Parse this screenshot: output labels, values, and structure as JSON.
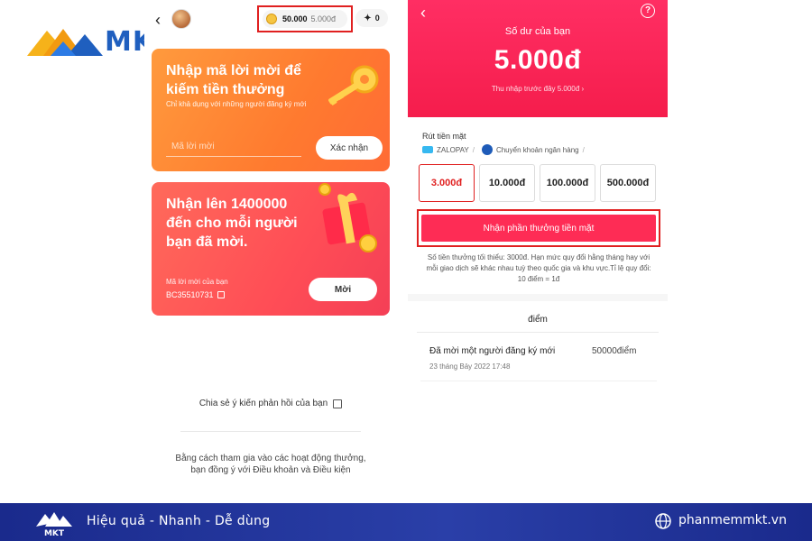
{
  "logo": {
    "text": "MKT"
  },
  "left_screen": {
    "coins": {
      "amount": "50.000",
      "cash_value": "5.000đ"
    },
    "tickets": {
      "count": "0"
    },
    "invite_card": {
      "title": "Nhập mã lời mời để kiếm tiền thưởng",
      "subtitle": "Chỉ khả dụng với những người đăng ký mới",
      "input_placeholder": "Mã lời mời",
      "confirm_label": "Xác nhận"
    },
    "reward_card": {
      "title": "Nhận lên 1400000 đến cho mỗi người bạn đã mời.",
      "code_label": "Mã lời mời của bạn",
      "code_value": "BC35510731",
      "invite_label": "Mời"
    },
    "feedback": "Chia sẻ ý kiến phản hồi của bạn",
    "terms": "Bằng cách tham gia vào các hoạt động thưởng, bạn đồng ý với Điều khoản và Điều kiện"
  },
  "right_screen": {
    "balance_label": "Số dư của bạn",
    "balance_value": "5.000đ",
    "prev_income": "Thu nhập trước đây 5.000đ",
    "withdraw_label": "Rút tiền mặt",
    "methods": [
      "ZALOPAY",
      "Chuyển khoản ngân hàng"
    ],
    "amounts": [
      {
        "label": "3.000đ",
        "selected": true
      },
      {
        "label": "10.000đ",
        "selected": false
      },
      {
        "label": "100.000đ",
        "selected": false
      },
      {
        "label": "500.000đ",
        "selected": false
      }
    ],
    "redeem_label": "Nhận phần thưởng tiền mặt",
    "min_note": "Số tiền thưởng tối thiểu: 3000đ. Hạn mức quy đổi hằng tháng hay với mỗi giao dịch sẽ khác nhau tuỳ theo quốc gia và khu vực.Tỉ lệ quy đổi: 10 điểm = 1đ",
    "points_title": "điểm",
    "history": [
      {
        "title": "Đã mời một người đăng ký mới",
        "date": "23 tháng Bảy 2022 17:48",
        "points": "50000điểm"
      }
    ]
  },
  "footer": {
    "slogan": "Hiệu quả - Nhanh - Dễ dùng",
    "website": "phanmemmkt.vn"
  },
  "colors": {
    "brand_blue": "#1f5fbf",
    "tiktok_red": "#fe2c55",
    "highlight_red": "#e02020",
    "invite_orange": "#ff7a2f",
    "footer_navy": "#1a2a8c"
  }
}
